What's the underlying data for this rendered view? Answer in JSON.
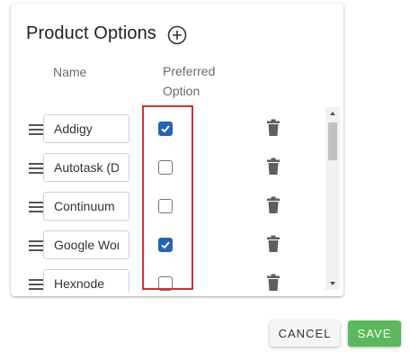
{
  "panel": {
    "title": "Product Options",
    "add_icon": "plus-circle-icon",
    "columns": {
      "name": "Name",
      "preferred": "Preferred\nOption"
    }
  },
  "products": [
    {
      "name": "Addigy",
      "preferred": true
    },
    {
      "name": "Autotask (D",
      "preferred": false
    },
    {
      "name": "Continuum",
      "preferred": false
    },
    {
      "name": "Google Wor",
      "preferred": true
    },
    {
      "name": "Hexnode",
      "preferred": false
    }
  ],
  "icons": {
    "drag": "drag-handle-icon",
    "delete": "trash-icon",
    "check": "checkmark-icon"
  },
  "colors": {
    "checkbox_checked": "#2563b8",
    "highlight": "#d32f2f",
    "save": "#5cb85c"
  },
  "footer": {
    "cancel_label": "CANCEL",
    "save_label": "SAVE"
  }
}
